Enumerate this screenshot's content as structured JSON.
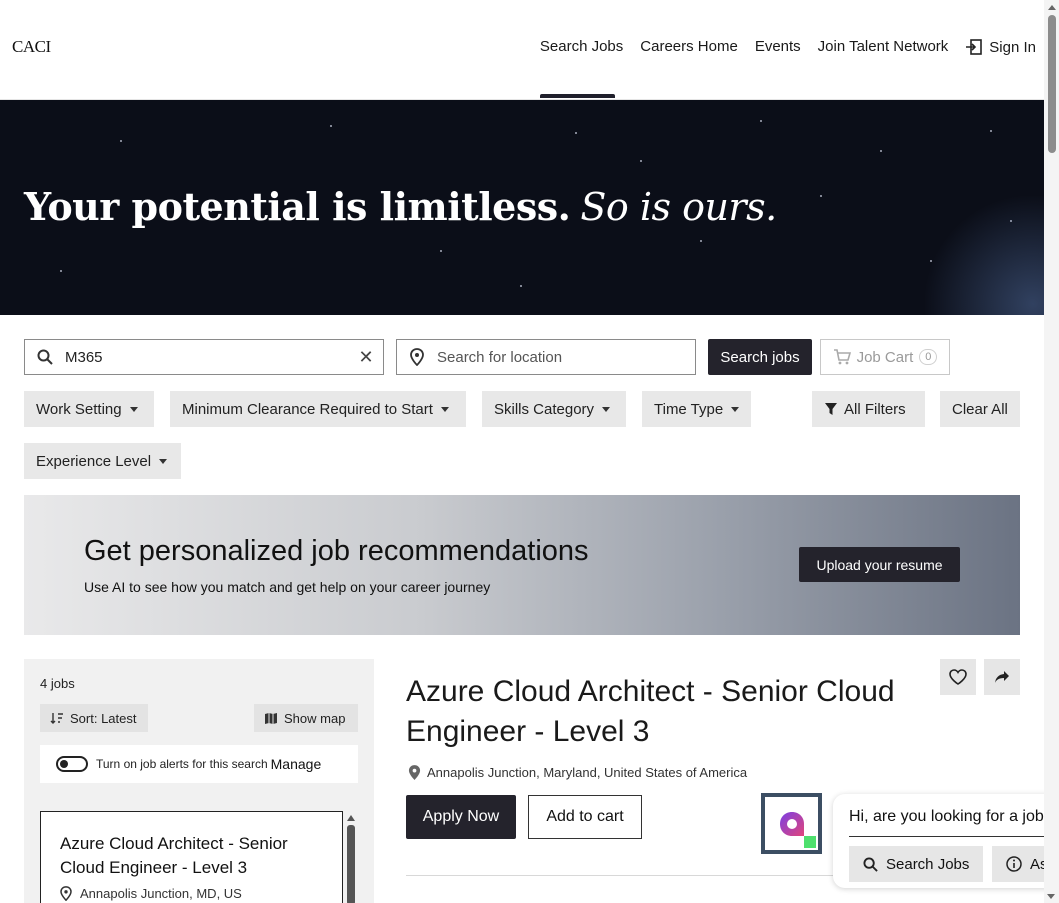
{
  "header": {
    "logo": "CACI",
    "nav": [
      {
        "label": "Search Jobs",
        "active": true
      },
      {
        "label": "Careers Home"
      },
      {
        "label": "Events"
      },
      {
        "label": "Join Talent Network"
      },
      {
        "label": "Sign In",
        "icon": "sign-in-icon"
      }
    ]
  },
  "hero": {
    "title_main": "Your potential is limitless.",
    "title_italic": "So is ours."
  },
  "search": {
    "keyword_value": "M365",
    "location_placeholder": "Search for location",
    "search_button": "Search jobs",
    "cart_label": "Job Cart",
    "cart_count": "0"
  },
  "filters": {
    "work_setting": "Work Setting",
    "clearance": "Minimum Clearance Required to Start",
    "skills": "Skills Category",
    "time_type": "Time Type",
    "all_filters": "All Filters",
    "clear_all": "Clear All",
    "experience": "Experience Level"
  },
  "banner": {
    "title": "Get personalized job recommendations",
    "subtitle": "Use AI to see how you match and get help on your career journey",
    "button": "Upload your resume"
  },
  "results": {
    "count": "4 jobs",
    "sort_label": "Sort: Latest",
    "map_label": "Show map",
    "alerts_text": "Turn on job alerts for this search",
    "manage": "Manage",
    "cards": [
      {
        "title": "Azure Cloud Architect - Senior Cloud Engineer - Level 3",
        "location": "Annapolis Junction, MD, US"
      }
    ]
  },
  "detail": {
    "title": "Azure Cloud Architect - Senior Cloud Engineer - Level 3",
    "location": "Annapolis Junction, Maryland, United States of America",
    "apply": "Apply Now",
    "add_to_cart": "Add to cart"
  },
  "chat": {
    "message": "Hi, are you looking for a job",
    "chip_search": "Search Jobs",
    "chip_other": "As"
  },
  "colors": {
    "primary_dark": "#24232c",
    "hero_bg": "#0b0e18",
    "filter_bg": "#e8e8e8",
    "bot_green": "#4ee06d"
  }
}
